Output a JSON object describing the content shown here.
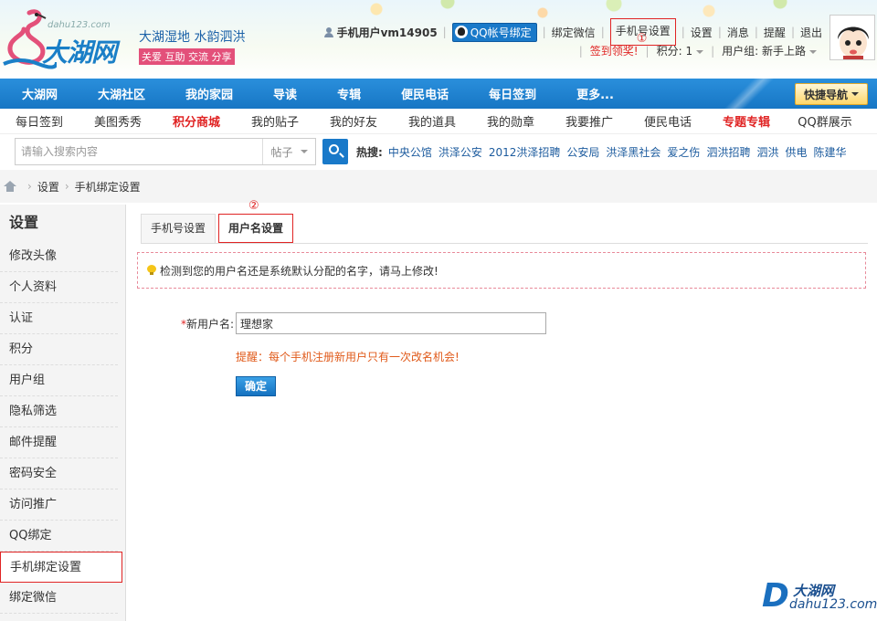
{
  "header": {
    "logo_domain": "dahu123.com",
    "logo_title": "大湖网",
    "slogan_line1": "大湖湿地  水韵泗洪",
    "slogan_line2": "关爱 互助 交流 分享",
    "username": "手机用户vm14905",
    "qq_bind": "QQ帐号绑定",
    "wechat_bind": "绑定微信",
    "phone_settings": "手机号设置",
    "phone_marker": "①",
    "settings": "设置",
    "messages": "消息",
    "reminders": "提醒",
    "logout": "退出",
    "checkin_reward": "签到领奖!",
    "points": "积分: 1",
    "user_group": "用户组: 新手上路"
  },
  "mainnav": {
    "items": [
      "大湖网",
      "大湖社区",
      "我的家园",
      "导读",
      "专辑",
      "便民电话",
      "每日签到",
      "更多..."
    ],
    "quick_nav": "快捷导航"
  },
  "subnav": {
    "items": [
      "每日签到",
      "美图秀秀",
      "积分商城",
      "我的贴子",
      "我的好友",
      "我的道具",
      "我的勋章",
      "我要推广",
      "便民电话",
      "专题专辑",
      "QQ群展示"
    ]
  },
  "search": {
    "placeholder": "请输入搜索内容",
    "type": "帖子",
    "hot_label": "热搜:",
    "hot_links": [
      "中央公馆",
      "洪泽公安",
      "2012洪泽招聘",
      "公安局",
      "洪泽黑社会",
      "爱之伤",
      "泗洪招聘",
      "泗洪",
      "供电",
      "陈建华"
    ]
  },
  "breadcrumb": {
    "items": [
      "设置",
      "手机绑定设置"
    ],
    "sep": "›"
  },
  "sidebar": {
    "title": "设置",
    "items": [
      "修改头像",
      "个人资料",
      "认证",
      "积分",
      "用户组",
      "隐私筛选",
      "邮件提醒",
      "密码安全",
      "访问推广",
      "QQ绑定",
      "手机绑定设置",
      "绑定微信"
    ]
  },
  "content": {
    "tabs": [
      "手机号设置",
      "用户名设置"
    ],
    "tab_marker": "②",
    "notice": "检测到您的用户名还是系统默认分配的名字，请马上修改!",
    "required_mark": "*",
    "field_label": "新用户名:",
    "field_value": "理想家",
    "hint": "提醒：每个手机注册新用户只有一次改名机会!",
    "confirm": "确定"
  },
  "watermark": {
    "letter": "D",
    "title": "大湖网",
    "domain": "dahu123.com"
  },
  "colors": {
    "brand_blue": "#1979c9",
    "highlight_red": "#e02424",
    "hint_orange": "#e05a1a"
  }
}
